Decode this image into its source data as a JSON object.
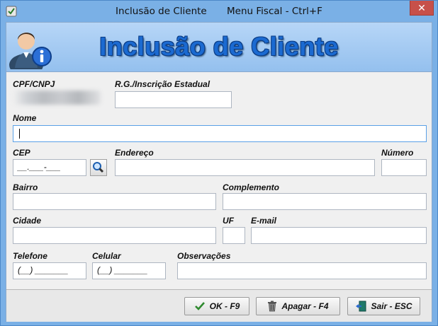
{
  "window": {
    "title": "Inclusão de Cliente",
    "title_suffix": "Menu Fiscal - Ctrl+F",
    "close_glyph": "✕"
  },
  "banner": {
    "title": "Inclusão de Cliente",
    "icon": "user-info-icon",
    "title_color": "#1b6ad1"
  },
  "form": {
    "cpf_cnpj": {
      "label": "CPF/CNPJ",
      "value": ""
    },
    "rg": {
      "label": "R.G./Inscrição Estadual",
      "value": ""
    },
    "nome": {
      "label": "Nome",
      "value": ""
    },
    "cep": {
      "label": "CEP",
      "value": "__.___-___"
    },
    "endereco": {
      "label": "Endereço",
      "value": ""
    },
    "numero": {
      "label": "Número",
      "value": ""
    },
    "bairro": {
      "label": "Bairro",
      "value": ""
    },
    "complemento": {
      "label": "Complemento",
      "value": ""
    },
    "cidade": {
      "label": "Cidade",
      "value": ""
    },
    "uf": {
      "label": "UF",
      "value": ""
    },
    "email": {
      "label": "E-mail",
      "value": ""
    },
    "telefone": {
      "label": "Telefone",
      "value": "(__) _______"
    },
    "celular": {
      "label": "Celular",
      "value": "(__) _______"
    },
    "observacoes": {
      "label": "Observações",
      "value": ""
    }
  },
  "buttons": {
    "ok": {
      "label": "OK - F9",
      "icon": "checkmark-icon"
    },
    "apagar": {
      "label": "Apagar - F4",
      "icon": "trash-icon"
    },
    "sair": {
      "label": "Sair - ESC",
      "icon": "exit-door-icon"
    }
  }
}
